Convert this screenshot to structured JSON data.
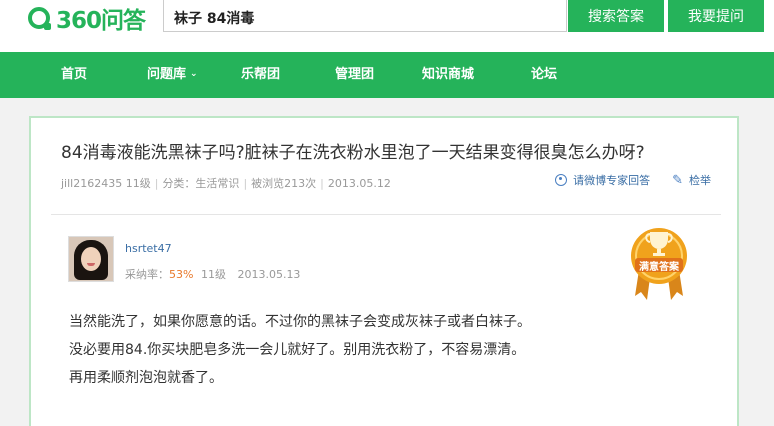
{
  "header": {
    "logo_text": "360问答",
    "search_value": "袜子 84消毒",
    "search_button": "搜索答案",
    "ask_button": "我要提问"
  },
  "nav": {
    "items": [
      {
        "label": "首页"
      },
      {
        "label": "问题库"
      },
      {
        "label": "乐帮团"
      },
      {
        "label": "管理团"
      },
      {
        "label": "知识商城"
      },
      {
        "label": "论坛"
      }
    ]
  },
  "question": {
    "title": "84消毒液能洗黑袜子吗?脏袜子在洗衣粉水里泡了一天结果变得很臭怎么办呀?",
    "author": "jill2162435",
    "level": "11级",
    "category": "分类：生活常识",
    "views": "被浏览213次",
    "date": "2013.05.12",
    "invite_link": "请微博专家回答",
    "report_link": "检举"
  },
  "answer": {
    "author": "hsrtet47",
    "adopt_label": "采纳率：",
    "adopt_rate": "53%",
    "level": "11级",
    "date": "2013.05.13",
    "badge": "满意答案",
    "lines": [
      "当然能洗了，如果你愿意的话。不过你的黑袜子会变成灰袜子或者白袜子。",
      "没必要用84.你买块肥皂多洗一会儿就好了。别用洗衣粉了，不容易漂清。",
      "再用柔顺剂泡泡就香了。"
    ]
  },
  "colors": {
    "brand_green": "#25b35a",
    "link_blue": "#3a6ea5",
    "rate_orange": "#e8782a",
    "badge_gold": "#f0a21c"
  }
}
